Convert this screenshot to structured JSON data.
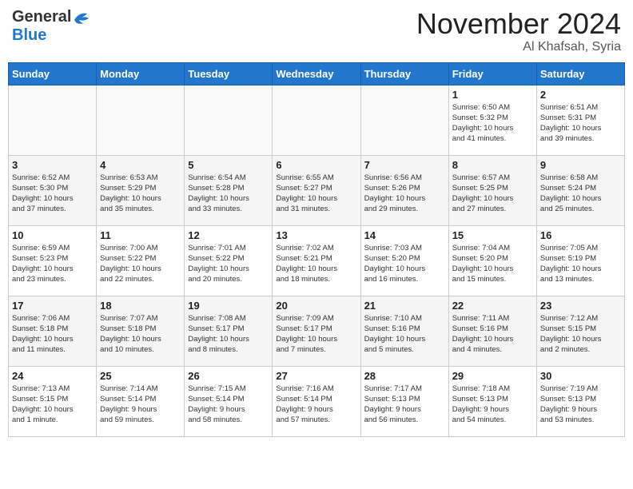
{
  "header": {
    "logo_general": "General",
    "logo_blue": "Blue",
    "month_title": "November 2024",
    "location": "Al Khafsah, Syria"
  },
  "weekdays": [
    "Sunday",
    "Monday",
    "Tuesday",
    "Wednesday",
    "Thursday",
    "Friday",
    "Saturday"
  ],
  "weeks": [
    [
      {
        "day": "",
        "info": ""
      },
      {
        "day": "",
        "info": ""
      },
      {
        "day": "",
        "info": ""
      },
      {
        "day": "",
        "info": ""
      },
      {
        "day": "",
        "info": ""
      },
      {
        "day": "1",
        "info": "Sunrise: 6:50 AM\nSunset: 5:32 PM\nDaylight: 10 hours\nand 41 minutes."
      },
      {
        "day": "2",
        "info": "Sunrise: 6:51 AM\nSunset: 5:31 PM\nDaylight: 10 hours\nand 39 minutes."
      }
    ],
    [
      {
        "day": "3",
        "info": "Sunrise: 6:52 AM\nSunset: 5:30 PM\nDaylight: 10 hours\nand 37 minutes."
      },
      {
        "day": "4",
        "info": "Sunrise: 6:53 AM\nSunset: 5:29 PM\nDaylight: 10 hours\nand 35 minutes."
      },
      {
        "day": "5",
        "info": "Sunrise: 6:54 AM\nSunset: 5:28 PM\nDaylight: 10 hours\nand 33 minutes."
      },
      {
        "day": "6",
        "info": "Sunrise: 6:55 AM\nSunset: 5:27 PM\nDaylight: 10 hours\nand 31 minutes."
      },
      {
        "day": "7",
        "info": "Sunrise: 6:56 AM\nSunset: 5:26 PM\nDaylight: 10 hours\nand 29 minutes."
      },
      {
        "day": "8",
        "info": "Sunrise: 6:57 AM\nSunset: 5:25 PM\nDaylight: 10 hours\nand 27 minutes."
      },
      {
        "day": "9",
        "info": "Sunrise: 6:58 AM\nSunset: 5:24 PM\nDaylight: 10 hours\nand 25 minutes."
      }
    ],
    [
      {
        "day": "10",
        "info": "Sunrise: 6:59 AM\nSunset: 5:23 PM\nDaylight: 10 hours\nand 23 minutes."
      },
      {
        "day": "11",
        "info": "Sunrise: 7:00 AM\nSunset: 5:22 PM\nDaylight: 10 hours\nand 22 minutes."
      },
      {
        "day": "12",
        "info": "Sunrise: 7:01 AM\nSunset: 5:22 PM\nDaylight: 10 hours\nand 20 minutes."
      },
      {
        "day": "13",
        "info": "Sunrise: 7:02 AM\nSunset: 5:21 PM\nDaylight: 10 hours\nand 18 minutes."
      },
      {
        "day": "14",
        "info": "Sunrise: 7:03 AM\nSunset: 5:20 PM\nDaylight: 10 hours\nand 16 minutes."
      },
      {
        "day": "15",
        "info": "Sunrise: 7:04 AM\nSunset: 5:20 PM\nDaylight: 10 hours\nand 15 minutes."
      },
      {
        "day": "16",
        "info": "Sunrise: 7:05 AM\nSunset: 5:19 PM\nDaylight: 10 hours\nand 13 minutes."
      }
    ],
    [
      {
        "day": "17",
        "info": "Sunrise: 7:06 AM\nSunset: 5:18 PM\nDaylight: 10 hours\nand 11 minutes."
      },
      {
        "day": "18",
        "info": "Sunrise: 7:07 AM\nSunset: 5:18 PM\nDaylight: 10 hours\nand 10 minutes."
      },
      {
        "day": "19",
        "info": "Sunrise: 7:08 AM\nSunset: 5:17 PM\nDaylight: 10 hours\nand 8 minutes."
      },
      {
        "day": "20",
        "info": "Sunrise: 7:09 AM\nSunset: 5:17 PM\nDaylight: 10 hours\nand 7 minutes."
      },
      {
        "day": "21",
        "info": "Sunrise: 7:10 AM\nSunset: 5:16 PM\nDaylight: 10 hours\nand 5 minutes."
      },
      {
        "day": "22",
        "info": "Sunrise: 7:11 AM\nSunset: 5:16 PM\nDaylight: 10 hours\nand 4 minutes."
      },
      {
        "day": "23",
        "info": "Sunrise: 7:12 AM\nSunset: 5:15 PM\nDaylight: 10 hours\nand 2 minutes."
      }
    ],
    [
      {
        "day": "24",
        "info": "Sunrise: 7:13 AM\nSunset: 5:15 PM\nDaylight: 10 hours\nand 1 minute."
      },
      {
        "day": "25",
        "info": "Sunrise: 7:14 AM\nSunset: 5:14 PM\nDaylight: 9 hours\nand 59 minutes."
      },
      {
        "day": "26",
        "info": "Sunrise: 7:15 AM\nSunset: 5:14 PM\nDaylight: 9 hours\nand 58 minutes."
      },
      {
        "day": "27",
        "info": "Sunrise: 7:16 AM\nSunset: 5:14 PM\nDaylight: 9 hours\nand 57 minutes."
      },
      {
        "day": "28",
        "info": "Sunrise: 7:17 AM\nSunset: 5:13 PM\nDaylight: 9 hours\nand 56 minutes."
      },
      {
        "day": "29",
        "info": "Sunrise: 7:18 AM\nSunset: 5:13 PM\nDaylight: 9 hours\nand 54 minutes."
      },
      {
        "day": "30",
        "info": "Sunrise: 7:19 AM\nSunset: 5:13 PM\nDaylight: 9 hours\nand 53 minutes."
      }
    ]
  ]
}
